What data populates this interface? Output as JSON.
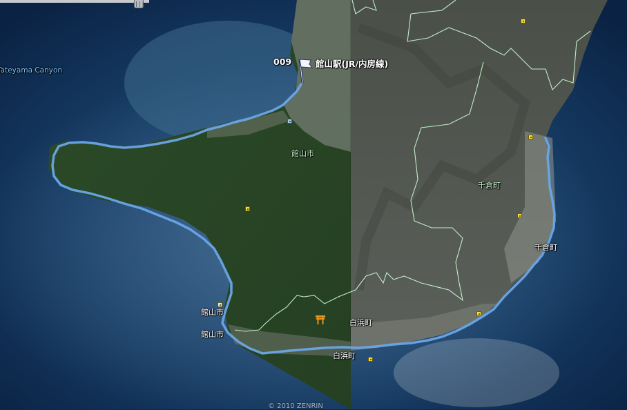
{
  "map": {
    "sea_label": "Tateyama Canyon",
    "placemark": {
      "number": "009",
      "label": "館山駅(JR/内房線)"
    },
    "place_labels": [
      "館山市",
      "千倉町",
      "千倉町",
      "館山市",
      "館山市",
      "白浜町",
      "白浜町"
    ],
    "copyright": "© 2010 ZENRIN",
    "colors": {
      "route": "#6aa6e6",
      "boundary": "#cfffd8",
      "sea": "#12355c",
      "land_vegetation": "#2f4e2b",
      "marker": "#f4e04a",
      "shrine": "#e8951e"
    },
    "icons": [
      "flag-icon",
      "shrine-icon",
      "poi-marker-icon",
      "scroll-handle-icon"
    ]
  }
}
